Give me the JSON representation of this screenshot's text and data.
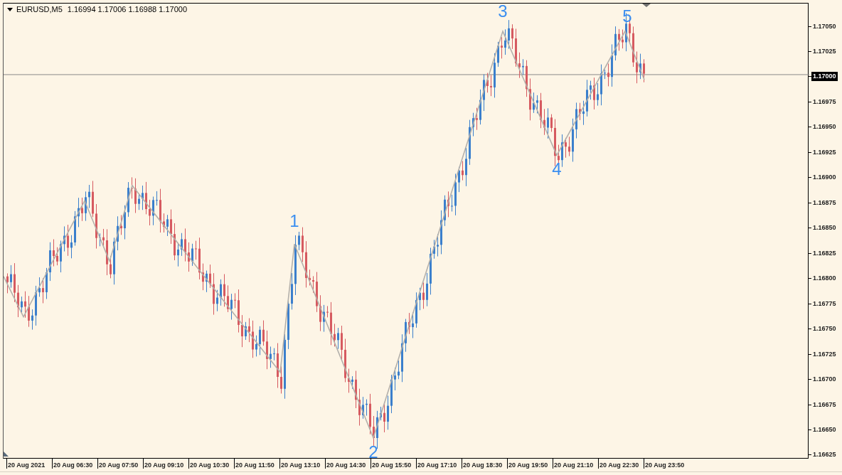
{
  "chart_header": {
    "symbol": "EURUSD,M5",
    "prices": [
      "1.16994",
      "1.17006",
      "1.16988",
      "1.17000"
    ]
  },
  "waves": [
    {
      "label": "1"
    },
    {
      "label": "2"
    },
    {
      "label": "3"
    },
    {
      "label": "4"
    },
    {
      "label": "5"
    }
  ],
  "price_axis": {
    "labels": [
      "1.17050",
      "1.17025",
      "1.16975",
      "1.16950",
      "1.16925",
      "1.16900",
      "1.16875",
      "1.16850",
      "1.16825",
      "1.16800",
      "1.16775",
      "1.16750",
      "1.16725",
      "1.16700",
      "1.16675",
      "1.16650",
      "1.16625"
    ],
    "current_price": "1.17000"
  },
  "time_axis": {
    "labels": [
      "20 Aug 2021",
      "20 Aug 06:30",
      "20 Aug 07:50",
      "20 Aug 09:10",
      "20 Aug 10:30",
      "20 Aug 11:50",
      "20 Aug 13:10",
      "20 Aug 14:30",
      "20 Aug 15:50",
      "20 Aug 17:10",
      "20 Aug 18:30",
      "20 Aug 19:50",
      "20 Aug 21:10",
      "20 Aug 22:30",
      "20 Aug 23:50"
    ]
  }
}
